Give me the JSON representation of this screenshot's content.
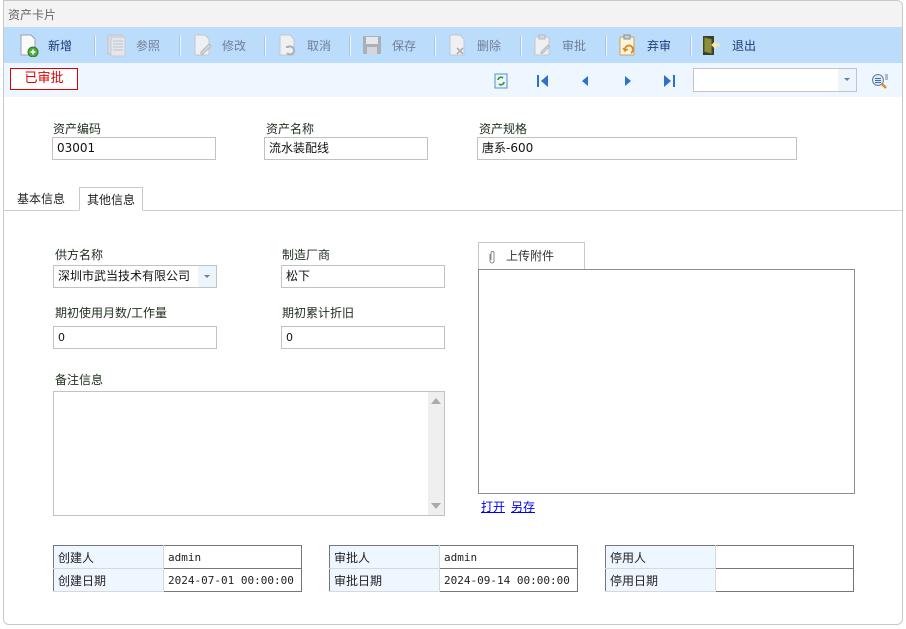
{
  "window": {
    "title": "资产卡片"
  },
  "toolbar": {
    "buttons": [
      {
        "label": "新增",
        "icon": "new-document-icon",
        "enabled": true
      },
      {
        "label": "参照",
        "icon": "reference-icon",
        "enabled": false
      },
      {
        "label": "修改",
        "icon": "edit-icon",
        "enabled": false
      },
      {
        "label": "取消",
        "icon": "cancel-icon",
        "enabled": false
      },
      {
        "label": "保存",
        "icon": "save-icon",
        "enabled": false
      },
      {
        "label": "删除",
        "icon": "delete-icon",
        "enabled": false
      },
      {
        "label": "审批",
        "icon": "approve-icon",
        "enabled": false
      },
      {
        "label": "弃审",
        "icon": "unapprove-icon",
        "enabled": true
      },
      {
        "label": "退出",
        "icon": "exit-door-icon",
        "enabled": true
      }
    ]
  },
  "navbar": {
    "status_label": "已审批",
    "status_color": "#dd0000",
    "icons": [
      "refresh-icon",
      "first-record-icon",
      "previous-record-icon",
      "next-record-icon",
      "last-record-icon"
    ],
    "record_select_value": "",
    "search_icon": "search-list-icon"
  },
  "header_fields": {
    "asset_code": {
      "label": "资产编码",
      "value": "03001"
    },
    "asset_name": {
      "label": "资产名称",
      "value": "流水装配线"
    },
    "asset_spec": {
      "label": "资产规格",
      "value": "唐系-600"
    }
  },
  "tabs": [
    {
      "label": "基本信息",
      "active": false
    },
    {
      "label": "其他信息",
      "active": true
    }
  ],
  "other_info": {
    "supplier": {
      "label": "供方名称",
      "value": "深圳市武当技术有限公司"
    },
    "manufacturer": {
      "label": "制造厂商",
      "value": "松下"
    },
    "initial_months": {
      "label": "期初使用月数/工作量",
      "value": "0"
    },
    "initial_depreciation": {
      "label": "期初累计折旧",
      "value": "0"
    },
    "remarks": {
      "label": "备注信息",
      "value": ""
    }
  },
  "attachment": {
    "tab_label": "上传附件",
    "open_link": "打开",
    "save_as_link": "另存"
  },
  "audit": {
    "created": {
      "by_label": "创建人",
      "by": "admin",
      "date_label": "创建日期",
      "date": "2024-07-01 00:00:00"
    },
    "approved": {
      "by_label": "审批人",
      "by": "admin",
      "date_label": "审批日期",
      "date": "2024-09-14 00:00:00"
    },
    "disabled": {
      "by_label": "停用人",
      "by": "",
      "date_label": "停用日期",
      "date": ""
    }
  }
}
